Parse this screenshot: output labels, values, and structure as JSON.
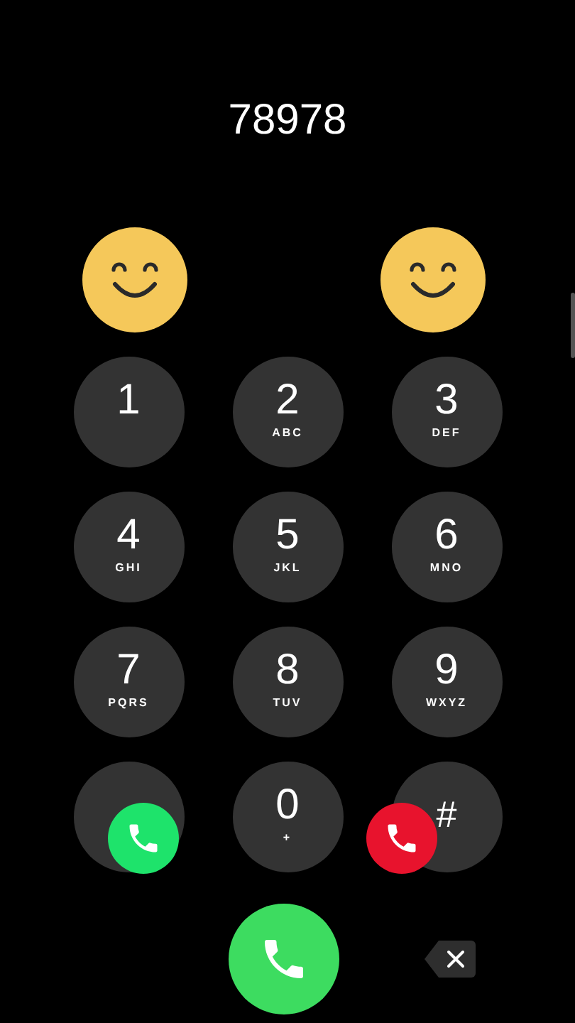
{
  "dialed_number": "78978",
  "emojis": [
    {
      "kind": "smiley"
    },
    {
      "kind": "smiley"
    }
  ],
  "keys": [
    {
      "digit": "1"
    },
    {
      "digit": "2",
      "letters": "ABC"
    },
    {
      "digit": "3",
      "letters": "DEF"
    },
    {
      "digit": "4",
      "letters": "GHI"
    },
    {
      "digit": "5",
      "letters": "JKL"
    },
    {
      "digit": "6",
      "letters": "MNO"
    },
    {
      "digit": "7",
      "letters": "PQRS"
    },
    {
      "digit": "8",
      "letters": "TUV"
    },
    {
      "digit": "9",
      "letters": "WXYZ"
    },
    {
      "digit": "0",
      "letters": "+"
    },
    {
      "digit": "#"
    }
  ],
  "floating_buttons": [
    {
      "kind": "accept"
    },
    {
      "kind": "decline"
    }
  ],
  "call_button": {
    "kind": "call"
  },
  "backspace": {
    "kind": "delete"
  }
}
